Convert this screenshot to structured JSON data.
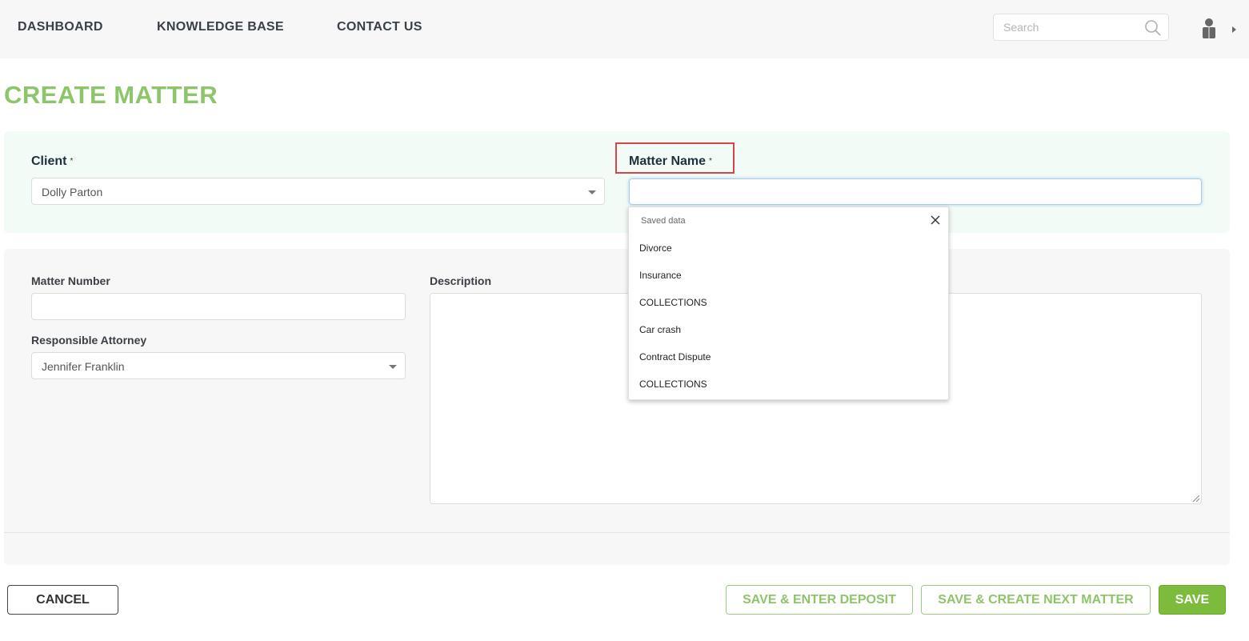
{
  "nav": {
    "dashboard": "DASHBOARD",
    "knowledge_base": "KNOWLEDGE BASE",
    "contact_us": "CONTACT US"
  },
  "search": {
    "placeholder": "Search",
    "icon": "search-icon"
  },
  "user_menu": {
    "icon": "user-icon",
    "caret": "caret-right-icon"
  },
  "page": {
    "title": "CREATE MATTER"
  },
  "form": {
    "client_label": "Client",
    "client_required": "*",
    "client_value": "Dolly Parton",
    "matter_name_label": "Matter Name",
    "matter_name_required": "*",
    "matter_name_value": "",
    "matter_number_label": "Matter Number",
    "matter_number_value": "",
    "responsible_attorney_label": "Responsible Attorney",
    "responsible_attorney_value": "Jennifer Franklin",
    "description_label": "Description",
    "description_value": ""
  },
  "autocomplete": {
    "header": "Saved data",
    "close_icon": "close-icon",
    "items": [
      "Divorce",
      "Insurance",
      "COLLECTIONS",
      "Car crash",
      "Contract Dispute",
      "COLLECTIONS"
    ]
  },
  "actions": {
    "cancel": "CANCEL",
    "save_enter_deposit": "SAVE & ENTER DEPOSIT",
    "save_create_next": "SAVE & CREATE NEXT MATTER",
    "save": "SAVE"
  },
  "colors": {
    "title_green": "#8dc56b",
    "save_green": "#7dbb3c",
    "highlight_red": "#d9444b"
  }
}
